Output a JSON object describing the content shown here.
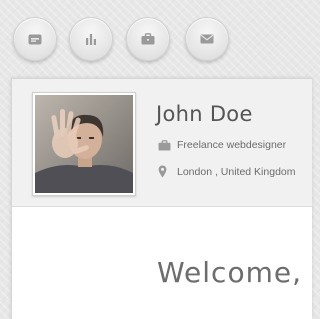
{
  "nav": {
    "items": [
      {
        "icon": "card-icon"
      },
      {
        "icon": "bar-chart-icon"
      },
      {
        "icon": "briefcase-icon"
      },
      {
        "icon": "envelope-icon"
      }
    ]
  },
  "profile": {
    "name": "John Doe",
    "occupation": "Freelance webdesigner",
    "location": "London , United Kingdom",
    "occupation_icon": "briefcase-icon",
    "location_icon": "map-pin-icon"
  },
  "main": {
    "welcome": "Welcome,"
  },
  "colors": {
    "background": "#e7e7e7",
    "icon": "#9a9a9a",
    "text": "#555555"
  }
}
